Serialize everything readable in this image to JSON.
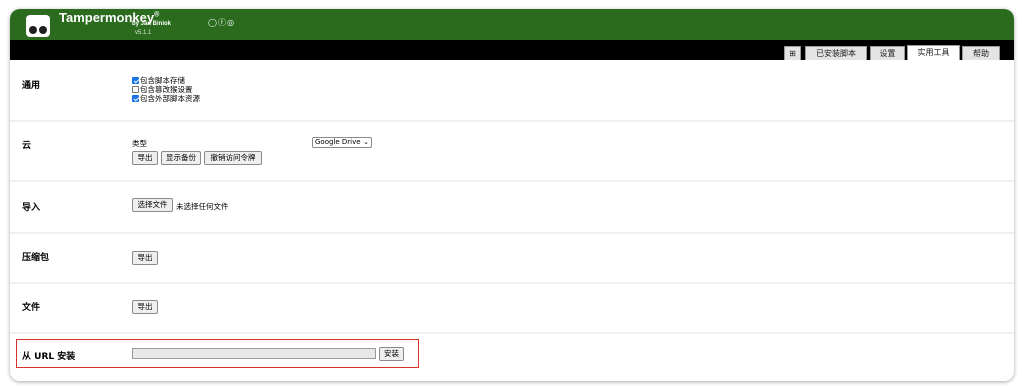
{
  "header": {
    "brand": "Tampermonkey",
    "brand_mark": "®",
    "byline": "by Jan Biniok",
    "byline_icons": "◯ⓕ◎",
    "version": "v5.1.1"
  },
  "tabs": [
    {
      "label": "⊞",
      "icon": "dashboard-icon"
    },
    {
      "label": "已安装脚本"
    },
    {
      "label": "设置"
    },
    {
      "label": "实用工具"
    },
    {
      "label": "帮助"
    }
  ],
  "sections": {
    "general": {
      "title": "通用",
      "options": [
        {
          "label": "包含脚本存储",
          "checked": true
        },
        {
          "label": "包含篡改猴设置",
          "checked": false
        },
        {
          "label": "包含外部脚本资源",
          "checked": true
        }
      ]
    },
    "cloud": {
      "title": "云",
      "type_label": "类型",
      "type_value": "Google Drive",
      "buttons": [
        "导出",
        "显示备份",
        "撤销访问令牌"
      ]
    },
    "import": {
      "title": "导入",
      "button": "选择文件",
      "status": "未选择任何文件"
    },
    "zip": {
      "title": "压缩包",
      "button": "导出"
    },
    "file": {
      "title": "文件",
      "button": "导出"
    },
    "url_install": {
      "title": "从 URL 安装",
      "input_value": "",
      "button": "安装"
    }
  },
  "colors": {
    "header_bg": "#2a6b1e",
    "highlight": "#d9302a",
    "checkbox": "#1a73e8"
  }
}
